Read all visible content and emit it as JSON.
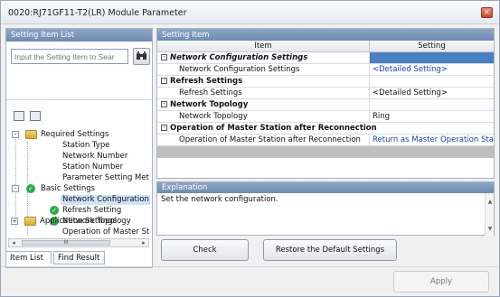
{
  "window": {
    "title": "0020:RJ71GF11-T2(LR) Module Parameter",
    "close_glyph": "✕"
  },
  "left_panel": {
    "header": "Setting Item List",
    "search_placeholder": "Input the Setting Item to Sear",
    "tree": [
      {
        "label": "Required Settings",
        "level": 1,
        "icon": "folder-icon"
      },
      {
        "label": "Station Type",
        "level": 2
      },
      {
        "label": "Network Number",
        "level": 2
      },
      {
        "label": "Station Number",
        "level": 2
      },
      {
        "label": "Parameter Setting Meth",
        "level": 2
      },
      {
        "label": "Basic Settings",
        "level": 1,
        "icon": "check-icon"
      },
      {
        "label": "Network Configuration",
        "level": 2,
        "selected": true
      },
      {
        "label": "Refresh Setting",
        "level": 2,
        "icon": "check-icon"
      },
      {
        "label": "Network Topology",
        "level": 2,
        "icon": "check-icon"
      },
      {
        "label": "Operation of Master St",
        "level": 2
      },
      {
        "label": "Application Settings",
        "level": 1,
        "icon": "folder-icon"
      }
    ],
    "tabs": [
      "Item List",
      "Find Result"
    ],
    "scroll_thumb_glyph": "III"
  },
  "right_panel": {
    "header": "Setting Item",
    "columns": [
      "Item",
      "Setting"
    ],
    "rows": [
      {
        "item": "Network Configuration Settings",
        "value": "",
        "category": true,
        "italic": true
      },
      {
        "item": "Network Configuration Settings",
        "value": "<Detailed Setting>",
        "blue": true
      },
      {
        "item": "Refresh Settings",
        "value": "",
        "category": true
      },
      {
        "item": "Refresh Settings",
        "value": "<Detailed Setting>"
      },
      {
        "item": "Network Topology",
        "value": "",
        "category": true
      },
      {
        "item": "Network Topology",
        "value": "Ring"
      },
      {
        "item": "Operation of Master Station after Reconnection",
        "value": "",
        "category": true
      },
      {
        "item": "Operation of Master Station after Reconnection",
        "value": "Return as Master Operation Stat",
        "blue": true
      }
    ]
  },
  "explanation": {
    "header": "Explanation",
    "text": "Set the network configuration."
  },
  "buttons": {
    "check": "Check",
    "restore": "Restore the Default Settings",
    "apply": "Apply"
  },
  "colors": {
    "header_blue": "#7a94b9",
    "selection": "#cfe2f7",
    "link_blue": "#1a3fa6",
    "check_green": "#2fa84a"
  }
}
